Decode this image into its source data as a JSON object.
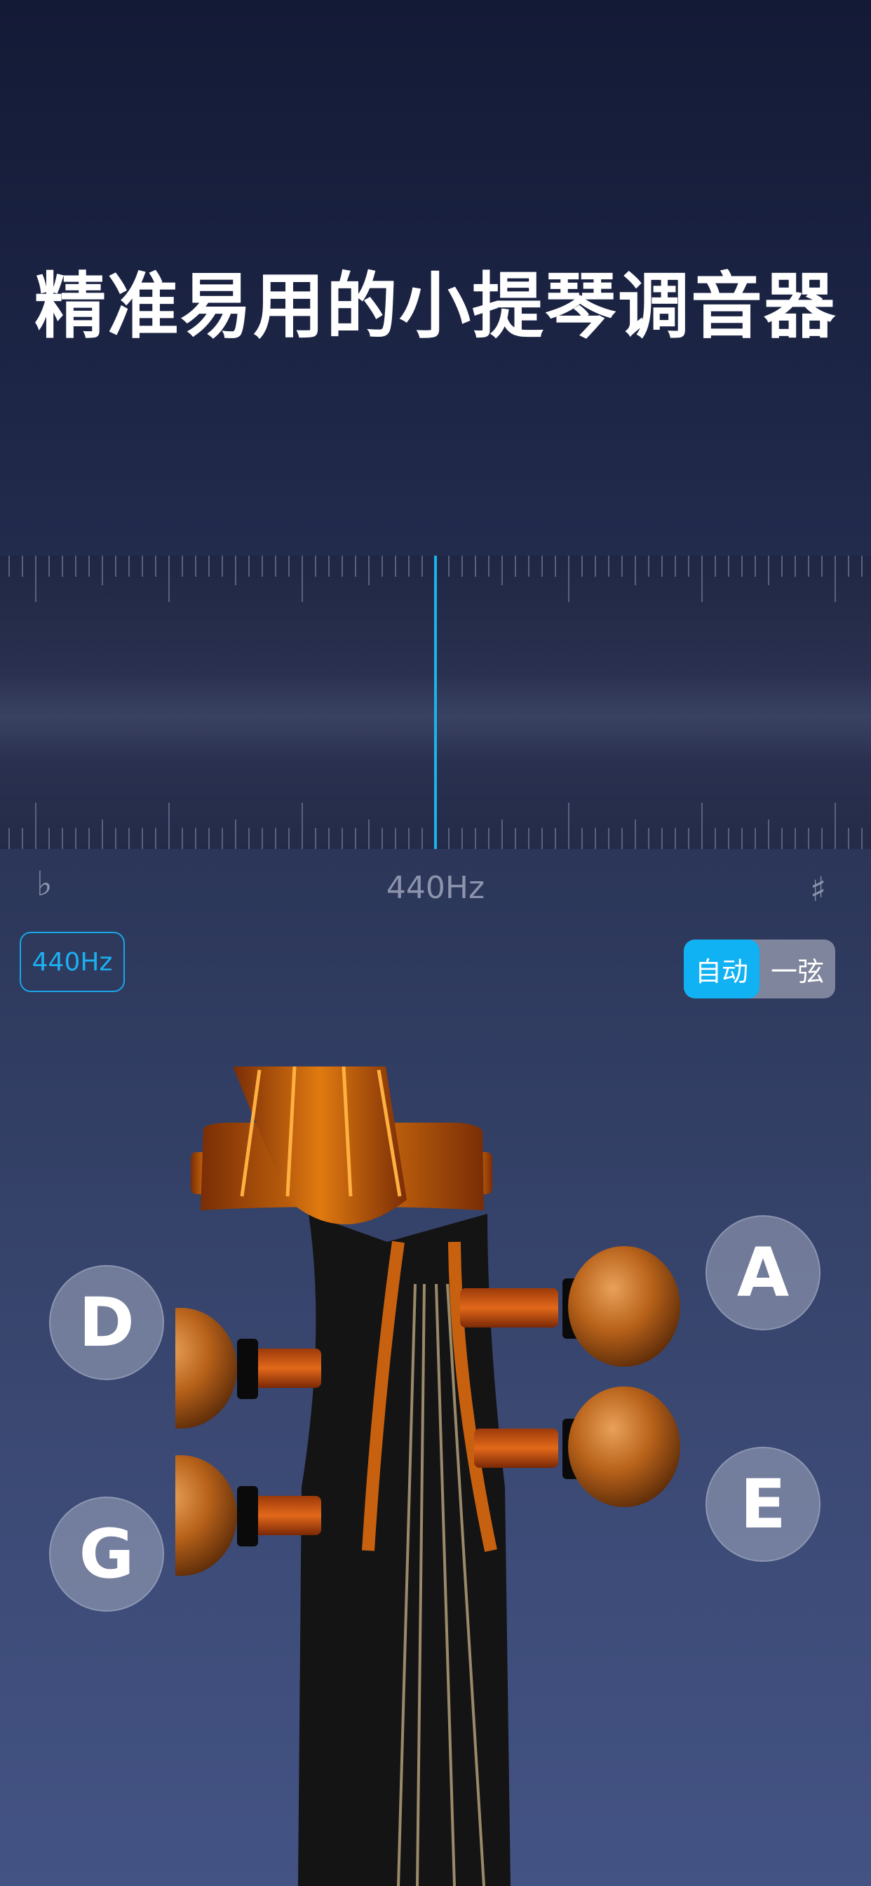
{
  "headline": "精准易用的小提琴调音器",
  "meter": {
    "flat_symbol": "♭",
    "sharp_symbol": "♯",
    "frequency_label": "440Hz",
    "needle_position": 0.0,
    "needle_color": "#19b4ee"
  },
  "reference_button": "440Hz",
  "mode_toggle": {
    "options": [
      "自动",
      "一弦"
    ],
    "selected": "自动"
  },
  "strings": {
    "left_top": "D",
    "left_bottom": "G",
    "right_top": "A",
    "right_bottom": "E"
  },
  "colors": {
    "accent": "#10b2f3",
    "background_top": "#131a36",
    "background_bottom": "#435384"
  }
}
